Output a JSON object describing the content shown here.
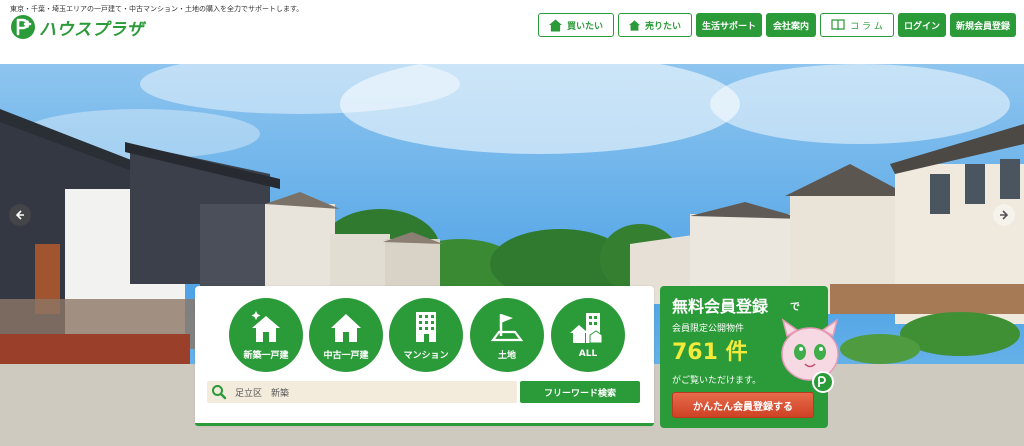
{
  "header": {
    "tagline": "東京・千葉・埼玉エリアの一戸建て・中古マンション・土地の購入を全力でサポートします。",
    "logo_text": "ハウスプラザ",
    "nav": [
      {
        "label": "買いたい",
        "icon": "house-icon",
        "style": "outline"
      },
      {
        "label": "売りたい",
        "icon": "house-icon",
        "style": "outline"
      },
      {
        "label": "生活サポート",
        "style": "solid"
      },
      {
        "label": "会社案内",
        "style": "solid"
      },
      {
        "label": "コ ラ ム",
        "icon": "book-icon",
        "style": "outline"
      },
      {
        "label": "ログイン",
        "style": "solid"
      },
      {
        "label": "新規会員登録",
        "style": "solid"
      }
    ]
  },
  "search": {
    "categories": [
      {
        "label": "新築一戸建",
        "icon": "new-house-icon"
      },
      {
        "label": "中古一戸建",
        "icon": "house-icon"
      },
      {
        "label": "マンション",
        "icon": "building-icon"
      },
      {
        "label": "土地",
        "icon": "land-flag-icon"
      },
      {
        "label": "ALL",
        "icon": "all-properties-icon"
      }
    ],
    "input_value": "足立区　新築",
    "button_label": "フリーワード検索"
  },
  "member": {
    "title": "無料会員登録",
    "title_suffix": "で",
    "subtitle": "会員限定公開物件",
    "count": "761 件",
    "note": "がご覧いただけます。",
    "button_label": "かんたん会員登録する"
  },
  "colors": {
    "brand_green": "#2b9a39",
    "accent_yellow": "#f4ea3a",
    "cta_red": "#d9502f"
  }
}
